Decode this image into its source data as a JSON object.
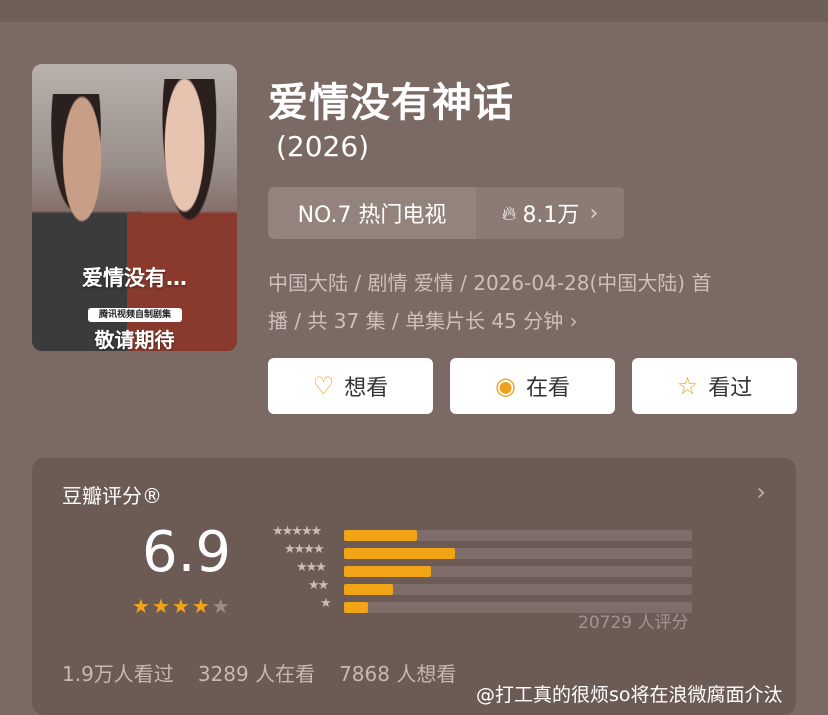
{
  "poster": {
    "title": "爱情没有…",
    "badge": "腾讯视频自制剧集",
    "subtitle": "敬请期待"
  },
  "show": {
    "title": "爱情没有神话",
    "year": "(2026)",
    "rank": "NO.7 热门电视",
    "heat": "8.1万",
    "meta_line1": "中国大陆 / 剧情 爱情 / 2026-04-28(中国大陆) 首",
    "meta_line2": "播 / 共 37 集 / 单集片长 45 分钟 ›"
  },
  "actions": [
    {
      "label": "想看",
      "icon": "heart-plus-icon"
    },
    {
      "label": "在看",
      "icon": "watching-dot-icon"
    },
    {
      "label": "看过",
      "icon": "star-outline-icon"
    }
  ],
  "rating": {
    "label": "豆瓣评分®",
    "score": "6.9",
    "stars": 3.5,
    "count": "20729 人评分",
    "stats": [
      "1.9万人看过",
      "3289 人在看",
      "7868 人想看"
    ]
  },
  "chart_data": {
    "type": "bar",
    "categories": [
      "5星",
      "4星",
      "3星",
      "2星",
      "1星"
    ],
    "values": [
      21,
      32,
      25,
      14,
      7
    ],
    "xlim": [
      0,
      100
    ]
  },
  "watermark": "@打工真的很烦so将在浪微腐面介汰",
  "colors": {
    "accent": "#f2a417",
    "background": "#7b6963",
    "card": "#6c5a55"
  }
}
